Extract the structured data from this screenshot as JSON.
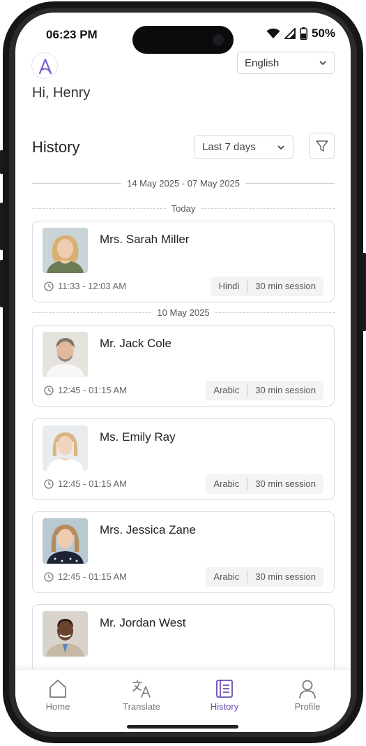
{
  "status_bar": {
    "time": "06:23 PM",
    "battery": "50%"
  },
  "header": {
    "language": "English",
    "greeting": "Hi, Henry"
  },
  "history": {
    "title": "History",
    "range": "Last 7 days",
    "date_range": "14 May 2025 - 07 May 2025",
    "groups": [
      {
        "label": "Today"
      },
      {
        "label": "10 May 2025"
      }
    ],
    "sessions": [
      {
        "name": "Mrs. Sarah Miller",
        "time": "11:33 - 12:03 AM",
        "language": "Hindi",
        "duration": "30 min session"
      },
      {
        "name": "Mr. Jack Cole",
        "time": "12:45 - 01:15 AM",
        "language": "Arabic",
        "duration": "30 min session"
      },
      {
        "name": "Ms. Emily Ray",
        "time": "12:45 - 01:15 AM",
        "language": "Arabic",
        "duration": "30 min session"
      },
      {
        "name": "Mrs. Jessica Zane",
        "time": "12:45 - 01:15 AM",
        "language": "Arabic",
        "duration": "30 min session"
      },
      {
        "name": "Mr. Jordan West",
        "time": "",
        "language": "",
        "duration": ""
      }
    ]
  },
  "nav": {
    "items": [
      {
        "label": "Home"
      },
      {
        "label": "Translate"
      },
      {
        "label": "History"
      },
      {
        "label": "Profile"
      }
    ]
  },
  "colors": {
    "accent": "#6b4bb0",
    "logo": "#7b5bc8"
  }
}
